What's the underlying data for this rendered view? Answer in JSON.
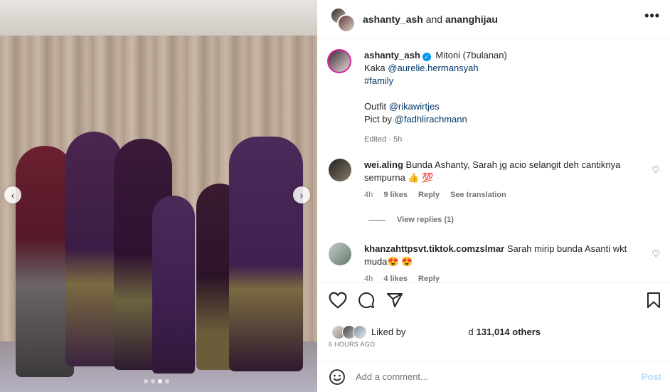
{
  "header": {
    "user1": "ashanty_ash",
    "and_text": "and",
    "user2": "ananghijau"
  },
  "caption": {
    "username": "ashanty_ash",
    "line1": "Mitoni (7bulanan)",
    "line2_prefix": "Kaka",
    "mention1": "@aurelie.hermansyah",
    "hashtag": "#family",
    "line3_prefix": "Outfit",
    "mention2": "@rikawirtjes",
    "line4_prefix": "Pict by",
    "mention3": "@fadhlirachmann",
    "meta": "Edited · 5h"
  },
  "comments": [
    {
      "username": "wei.aling",
      "text": "Bunda Ashanty, Sarah jg acio selangit deh cantiknya sempurna 👍 💯",
      "time": "4h",
      "likes": "9 likes",
      "reply": "Reply",
      "translate": "See translation"
    },
    {
      "username": "khanzahttpsvt.tiktok.comzslmar",
      "text": "Sarah mirip bunda Asanti wkt muda😍 😍",
      "time": "4h",
      "likes": "4 likes",
      "reply": "Reply"
    }
  ],
  "view_replies": "View replies (1)",
  "likes": {
    "prefix": "Liked by",
    "count": "131,014 others",
    "joiner": "d"
  },
  "timestamp": "6 HOURS AGO",
  "add_comment": {
    "placeholder": "Add a comment...",
    "post": "Post"
  },
  "icons": {
    "more": "more-icon",
    "like": "heart-icon",
    "comment": "comment-icon",
    "share": "share-icon",
    "save": "bookmark-icon",
    "emoji": "emoji-icon"
  },
  "colors": {
    "link": "#00376b",
    "verified": "#0095f6",
    "post": "#b3dbff"
  }
}
